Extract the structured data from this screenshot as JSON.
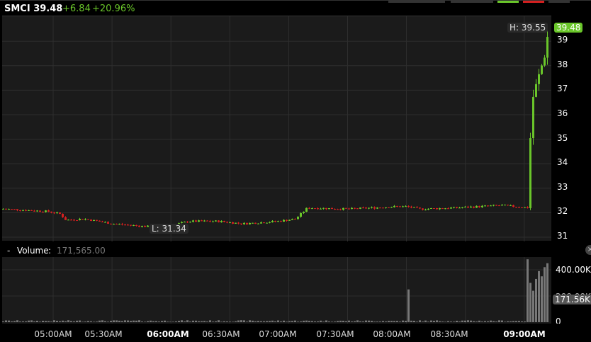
{
  "header": {
    "symbol": "SMCI",
    "price": "39.48",
    "change": "+6.84",
    "change_pct": "+20.96%"
  },
  "colors": {
    "up": "#6ac62a",
    "down": "#d42020",
    "grid": "#2e2e2e",
    "bg": "#1b1b1b",
    "volume": "#777777"
  },
  "price_pane": {
    "high_label": "H: 39.55",
    "low_label": "L: 31.34",
    "last_tag": "39.48",
    "y_ticks": [
      "39",
      "38",
      "37",
      "36",
      "35",
      "34",
      "33",
      "32",
      "31"
    ]
  },
  "volume_pane": {
    "title": "Volume",
    "value": "171,565.00",
    "last_tag": "171.56K",
    "y_ticks": [
      "400.00K",
      "200.00K",
      "0"
    ],
    "close_icon": "close-icon"
  },
  "x_axis": {
    "labels": [
      "05:00AM",
      "05:30AM",
      "06:00AM",
      "06:30AM",
      "07:00AM",
      "07:30AM",
      "08:00AM",
      "08:30AM",
      "09:00AM"
    ],
    "bold": [
      false,
      false,
      true,
      false,
      false,
      false,
      false,
      false,
      true
    ]
  },
  "chart_data": {
    "type": "candlestick",
    "ylim": [
      30.8,
      39.8
    ],
    "volume_ylim": [
      0,
      500000
    ],
    "price_path": [
      [
        4.6,
        32.15
      ],
      [
        4.95,
        32.05
      ],
      [
        5.05,
        31.95
      ],
      [
        5.1,
        31.7
      ],
      [
        5.25,
        31.75
      ],
      [
        5.5,
        31.55
      ],
      [
        5.75,
        31.45
      ],
      [
        5.9,
        31.4
      ],
      [
        6.0,
        31.5
      ],
      [
        6.15,
        31.65
      ],
      [
        6.4,
        31.65
      ],
      [
        6.6,
        31.55
      ],
      [
        6.9,
        31.65
      ],
      [
        7.05,
        31.75
      ],
      [
        7.15,
        32.2
      ],
      [
        7.5,
        32.15
      ],
      [
        7.9,
        32.25
      ],
      [
        8.0,
        32.25
      ],
      [
        8.1,
        32.15
      ],
      [
        8.4,
        32.2
      ],
      [
        8.8,
        32.3
      ],
      [
        9.03,
        32.2
      ],
      [
        9.05,
        36.5
      ],
      [
        9.1,
        37.2
      ],
      [
        9.15,
        38.2
      ],
      [
        9.2,
        39.48
      ]
    ],
    "volume_spikes": [
      [
        8.0,
        250000
      ],
      [
        9.02,
        480000
      ],
      [
        9.04,
        300000
      ],
      [
        9.06,
        240000
      ],
      [
        9.08,
        230000
      ],
      [
        9.1,
        330000
      ],
      [
        9.12,
        390000
      ],
      [
        9.14,
        350000
      ],
      [
        9.16,
        420000
      ],
      [
        9.18,
        450000
      ],
      [
        9.2,
        430000
      ]
    ]
  }
}
